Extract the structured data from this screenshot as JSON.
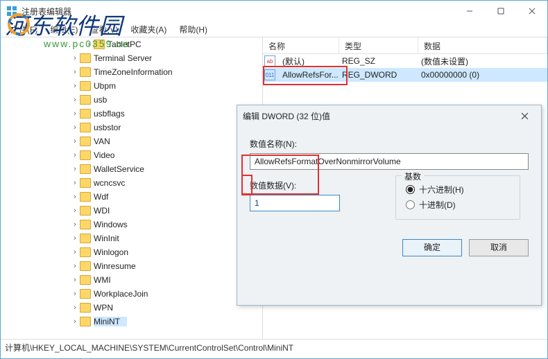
{
  "window": {
    "title": "注册表编辑器"
  },
  "menu": {
    "file": "文件(F)",
    "edit": "编辑(E)",
    "view": "查看(V)",
    "fav": "收藏夹(A)",
    "help": "帮助(H)"
  },
  "tree": [
    {
      "indent": 120,
      "label": "TabletPC"
    },
    {
      "indent": 100,
      "label": "Terminal Server"
    },
    {
      "indent": 100,
      "label": "TimeZoneInformation"
    },
    {
      "indent": 100,
      "label": "Ubpm"
    },
    {
      "indent": 100,
      "label": "usb"
    },
    {
      "indent": 100,
      "label": "usbflags"
    },
    {
      "indent": 100,
      "label": "usbstor"
    },
    {
      "indent": 100,
      "label": "VAN"
    },
    {
      "indent": 100,
      "label": "Video"
    },
    {
      "indent": 100,
      "label": "WalletService"
    },
    {
      "indent": 100,
      "label": "wcncsvc"
    },
    {
      "indent": 100,
      "label": "Wdf"
    },
    {
      "indent": 100,
      "label": "WDI"
    },
    {
      "indent": 100,
      "label": "Windows"
    },
    {
      "indent": 100,
      "label": "WinInit"
    },
    {
      "indent": 100,
      "label": "Winlogon"
    },
    {
      "indent": 100,
      "label": "Winresume"
    },
    {
      "indent": 100,
      "label": "WMI"
    },
    {
      "indent": 100,
      "label": "WorkplaceJoin"
    },
    {
      "indent": 100,
      "label": "WPN"
    },
    {
      "indent": 100,
      "label": "MiniNT",
      "sel": true
    }
  ],
  "list": {
    "cols": {
      "name": "名称",
      "type": "类型",
      "data": "数据"
    },
    "rows": [
      {
        "icon": "str",
        "icontxt": "ab",
        "name": "(默认)",
        "type": "REG_SZ",
        "data": "(数值未设置)"
      },
      {
        "icon": "num",
        "icontxt": "011",
        "name": "AllowRefsFor...",
        "type": "REG_DWORD",
        "data": "0x00000000 (0)",
        "sel": true
      }
    ]
  },
  "dialog": {
    "title": "编辑 DWORD (32 位)值",
    "name_label": "数值名称(N):",
    "name_value": "AllowRefsFormatOverNonmirrorVolume",
    "data_label": "数值数据(V):",
    "data_value": "1",
    "base_legend": "基数",
    "radio_hex": "十六进制(H)",
    "radio_dec": "十进制(D)",
    "ok": "确定",
    "cancel": "取消"
  },
  "status": {
    "path": "计算机\\HKEY_LOCAL_MACHINE\\SYSTEM\\CurrentControlSet\\Control\\MiniNT"
  },
  "watermark": {
    "main": "河东软件园",
    "sub": "www.pc0359.cn"
  }
}
